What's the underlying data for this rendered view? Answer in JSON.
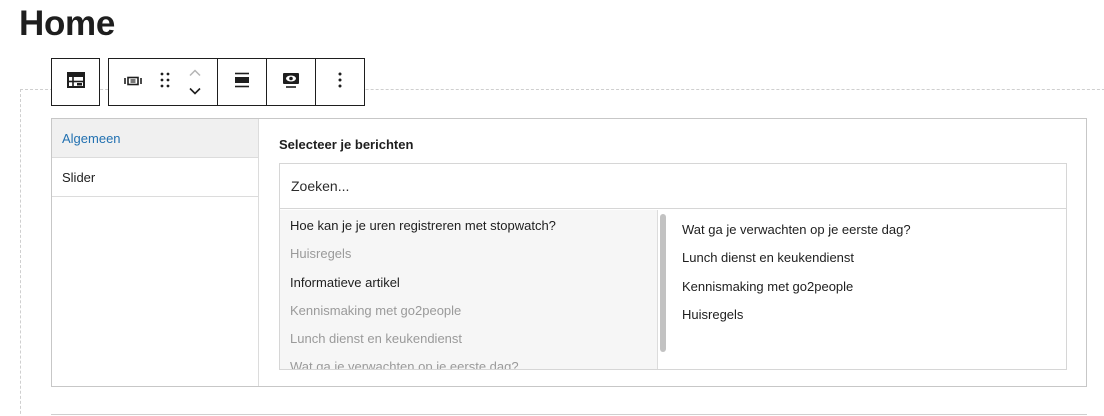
{
  "page": {
    "title": "Home"
  },
  "toolbar": {
    "icons": [
      "table-icon",
      "carousel-icon",
      "drag-handle-icon",
      "chevron-up-icon",
      "chevron-down-icon",
      "align-icon",
      "preview-eye-icon",
      "more-options-icon"
    ]
  },
  "tabs": [
    {
      "label": "Algemeen",
      "active": true
    },
    {
      "label": "Slider",
      "active": false
    }
  ],
  "panel": {
    "label": "Selecteer je berichten",
    "search": {
      "placeholder": "Zoeken..."
    },
    "available": [
      {
        "label": "Hoe kan je je uren registreren met stopwatch?",
        "selected": false
      },
      {
        "label": "Huisregels",
        "selected": true
      },
      {
        "label": "Informatieve artikel",
        "selected": false
      },
      {
        "label": "Kennismaking met go2people",
        "selected": true
      },
      {
        "label": "Lunch dienst en keukendienst",
        "selected": true
      },
      {
        "label": "Wat ga je verwachten op je eerste dag?",
        "selected": true
      }
    ],
    "chosen": [
      "Wat ga je verwachten op je eerste dag?",
      "Lunch dienst en keukendienst",
      "Kennismaking met go2people",
      "Huisregels"
    ]
  },
  "colors": {
    "accent": "#2271b1",
    "text": "#1e1e1e",
    "muted": "#9a9a9a",
    "tab_active_bg": "#f0f0f0",
    "list_bg": "#f6f6f6"
  }
}
